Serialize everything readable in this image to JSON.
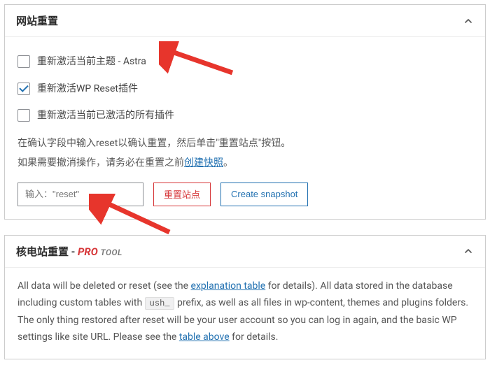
{
  "panel1": {
    "title": "网站重置",
    "checks": [
      {
        "label": "重新激活当前主题 - Astra",
        "checked": false
      },
      {
        "label": "重新激活WP Reset插件",
        "checked": true
      },
      {
        "label": "重新激活当前已激活的所有插件",
        "checked": false
      }
    ],
    "instr_line1_a": "在确认字段中输入",
    "instr_line1_b": "reset",
    "instr_line1_c": "以确认重置，然后单击\"重置站点\"按钮。",
    "instr_line2_a": "如果需要撤消操作，请务必在重置之前",
    "instr_link": "创建快照",
    "instr_line2_b": "。",
    "input_placeholder": "输入：\"reset\"",
    "btn_reset": "重置站点",
    "btn_snapshot": "Create snapshot"
  },
  "panel2": {
    "title": "核电站重置",
    "badge_pro": "PRO",
    "badge_tool": "TOOL",
    "desc_a": "All data will be deleted or reset (see the ",
    "link1": "explanation table",
    "desc_b": " for details). All data stored in the database including custom tables with ",
    "prefix": "ush_",
    "desc_c": " prefix, as well as all files in wp-content, themes and plugins folders. The only thing restored after reset will be your user account so you can log in again, and the basic WP settings like site URL. Please see the ",
    "link2": "table above",
    "desc_d": " for details."
  }
}
